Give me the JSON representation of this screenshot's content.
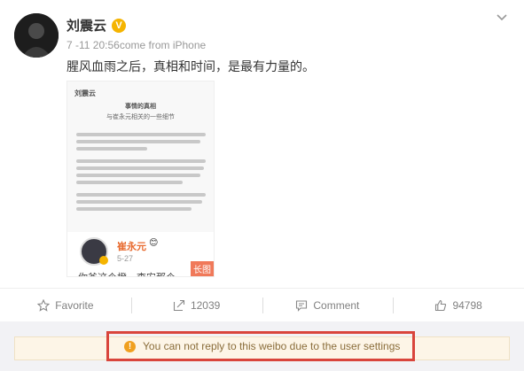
{
  "post": {
    "author": "刘震云",
    "verified_icon": "verified-v-icon",
    "meta": "7 -11 20:56come from iPhone",
    "text": "腥风血雨之后，真相和时间，是最有力量的。",
    "menu_icon": "chevron-down-icon"
  },
  "long_image": {
    "author": "刘震云",
    "title_line1": "事情的真相",
    "title_line2": "与崔永元相关的一些细节",
    "embed_name": "崔永元",
    "embed_emoji": "😊",
    "embed_date": "5-27",
    "embed_footer": "你爸这个橙…李安那个…",
    "label": "长图"
  },
  "actions": [
    {
      "label": "Favorite",
      "icon": "star-icon"
    },
    {
      "label": "12039",
      "icon": "share-icon"
    },
    {
      "label": "Comment",
      "icon": "comment-icon"
    },
    {
      "label": "94798",
      "icon": "thumbs-up-icon"
    }
  ],
  "notice": {
    "icon": "warning-icon",
    "text": "You can not reply to this weibo due to the user settings"
  },
  "colors": {
    "highlight": "#d9453c",
    "notice_bg": "#fdf5e7",
    "notice_text": "#8a6d3b",
    "verified": "#f5b400",
    "long_label": "#f0795a"
  }
}
